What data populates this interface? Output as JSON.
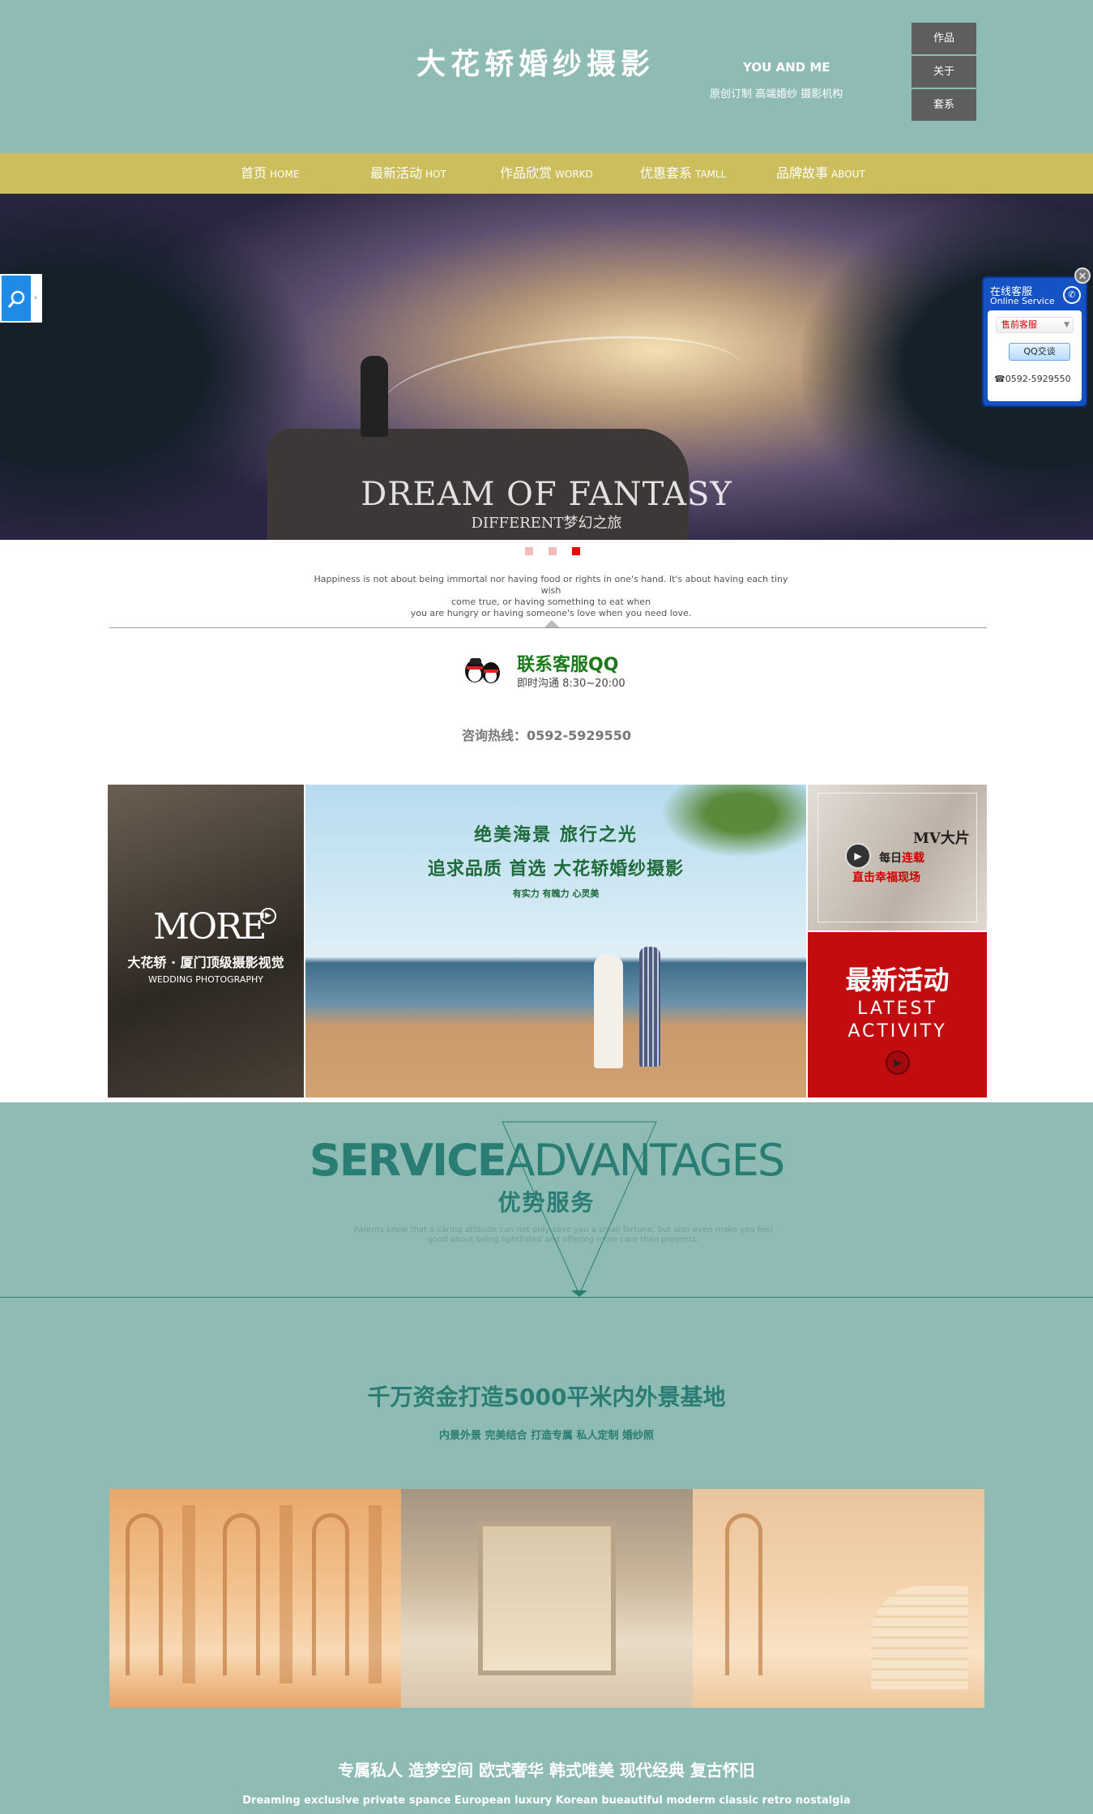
{
  "header": {
    "title": "大花轿婚纱摄影",
    "slogan_en": "YOU AND ME",
    "slogan_cn": "原创订制 高端婚纱 摄影机构",
    "quick_links": [
      "作品",
      "关于",
      "套系"
    ]
  },
  "nav": {
    "items": [
      {
        "cn": "首页",
        "en": "HOME"
      },
      {
        "cn": "最新活动",
        "en": "HOT"
      },
      {
        "cn": "作品欣赏",
        "en": "WORKD"
      },
      {
        "cn": "优惠套系",
        "en": "TAMLL"
      },
      {
        "cn": "品牌故事",
        "en": "ABOUT"
      }
    ]
  },
  "hero": {
    "title": "DREAM OF FANTASY",
    "subtitle": "DIFFERENT梦幻之旅",
    "slides": 3,
    "active_slide": 3
  },
  "intro": {
    "quote_line1": "Happiness is not about being immortal nor having food or rights in one's hand. It's about having each tiny wish",
    "quote_line2": "come true, or having something to eat when",
    "quote_line3": "you are hungry or having someone's love when you need love."
  },
  "contact": {
    "qq_title": "联系客服QQ",
    "qq_hours": "即时沟通 8:30~20:00",
    "hotline": "咨询热线：0592-5929550"
  },
  "banners": {
    "more": {
      "title": "MORE",
      "sub_cn": "大花轿 · 厦门顶级摄影视觉",
      "sub_en": "WEDDING PHOTOGRAPHY"
    },
    "beach": {
      "line1": "绝美海景  旅行之光",
      "line2": "追求品质 首选 大花轿婚纱摄影",
      "line3": "有实力   有魄力   心灵美"
    },
    "mv": {
      "title": "MV大片",
      "line2_prefix": "每日",
      "line2_red": "连载",
      "line3": "直击幸福现场"
    },
    "activity": {
      "cn": "最新活动",
      "en1": "LATEST",
      "en2": "ACTIVITY"
    }
  },
  "service": {
    "title_bold": "SERVICE",
    "title_light": "ADVANTAGES",
    "title_cn": "优势服务",
    "desc_line1": "Parents know that a caring attitude can not only save you a small fortune, but also even make you feel",
    "desc_line2": "good about being lightfisted and offering more care than presents."
  },
  "base": {
    "title": "千万资金打造5000平米内外景基地",
    "subtitle": "内景外景 完美结合 打造专属 私人定制 婚纱照"
  },
  "footer": {
    "cn": "专属私人 造梦空间 欧式奢华 韩式唯美 现代经典 复古怀旧",
    "en": "Dreaming exclusive private spance European luxury Korean bueautiful moderm classic retro nostalgia"
  },
  "online_service": {
    "title": "在线客服",
    "subtitle": "Online Service",
    "select_value": "售前客服",
    "qq_button": "QQ交谈",
    "phone": "0592-5929550"
  },
  "colors": {
    "background": "#8fbbb5",
    "nav": "#cdbe5d",
    "accent": "#2a7d72",
    "activity_red": "#c20c10"
  }
}
